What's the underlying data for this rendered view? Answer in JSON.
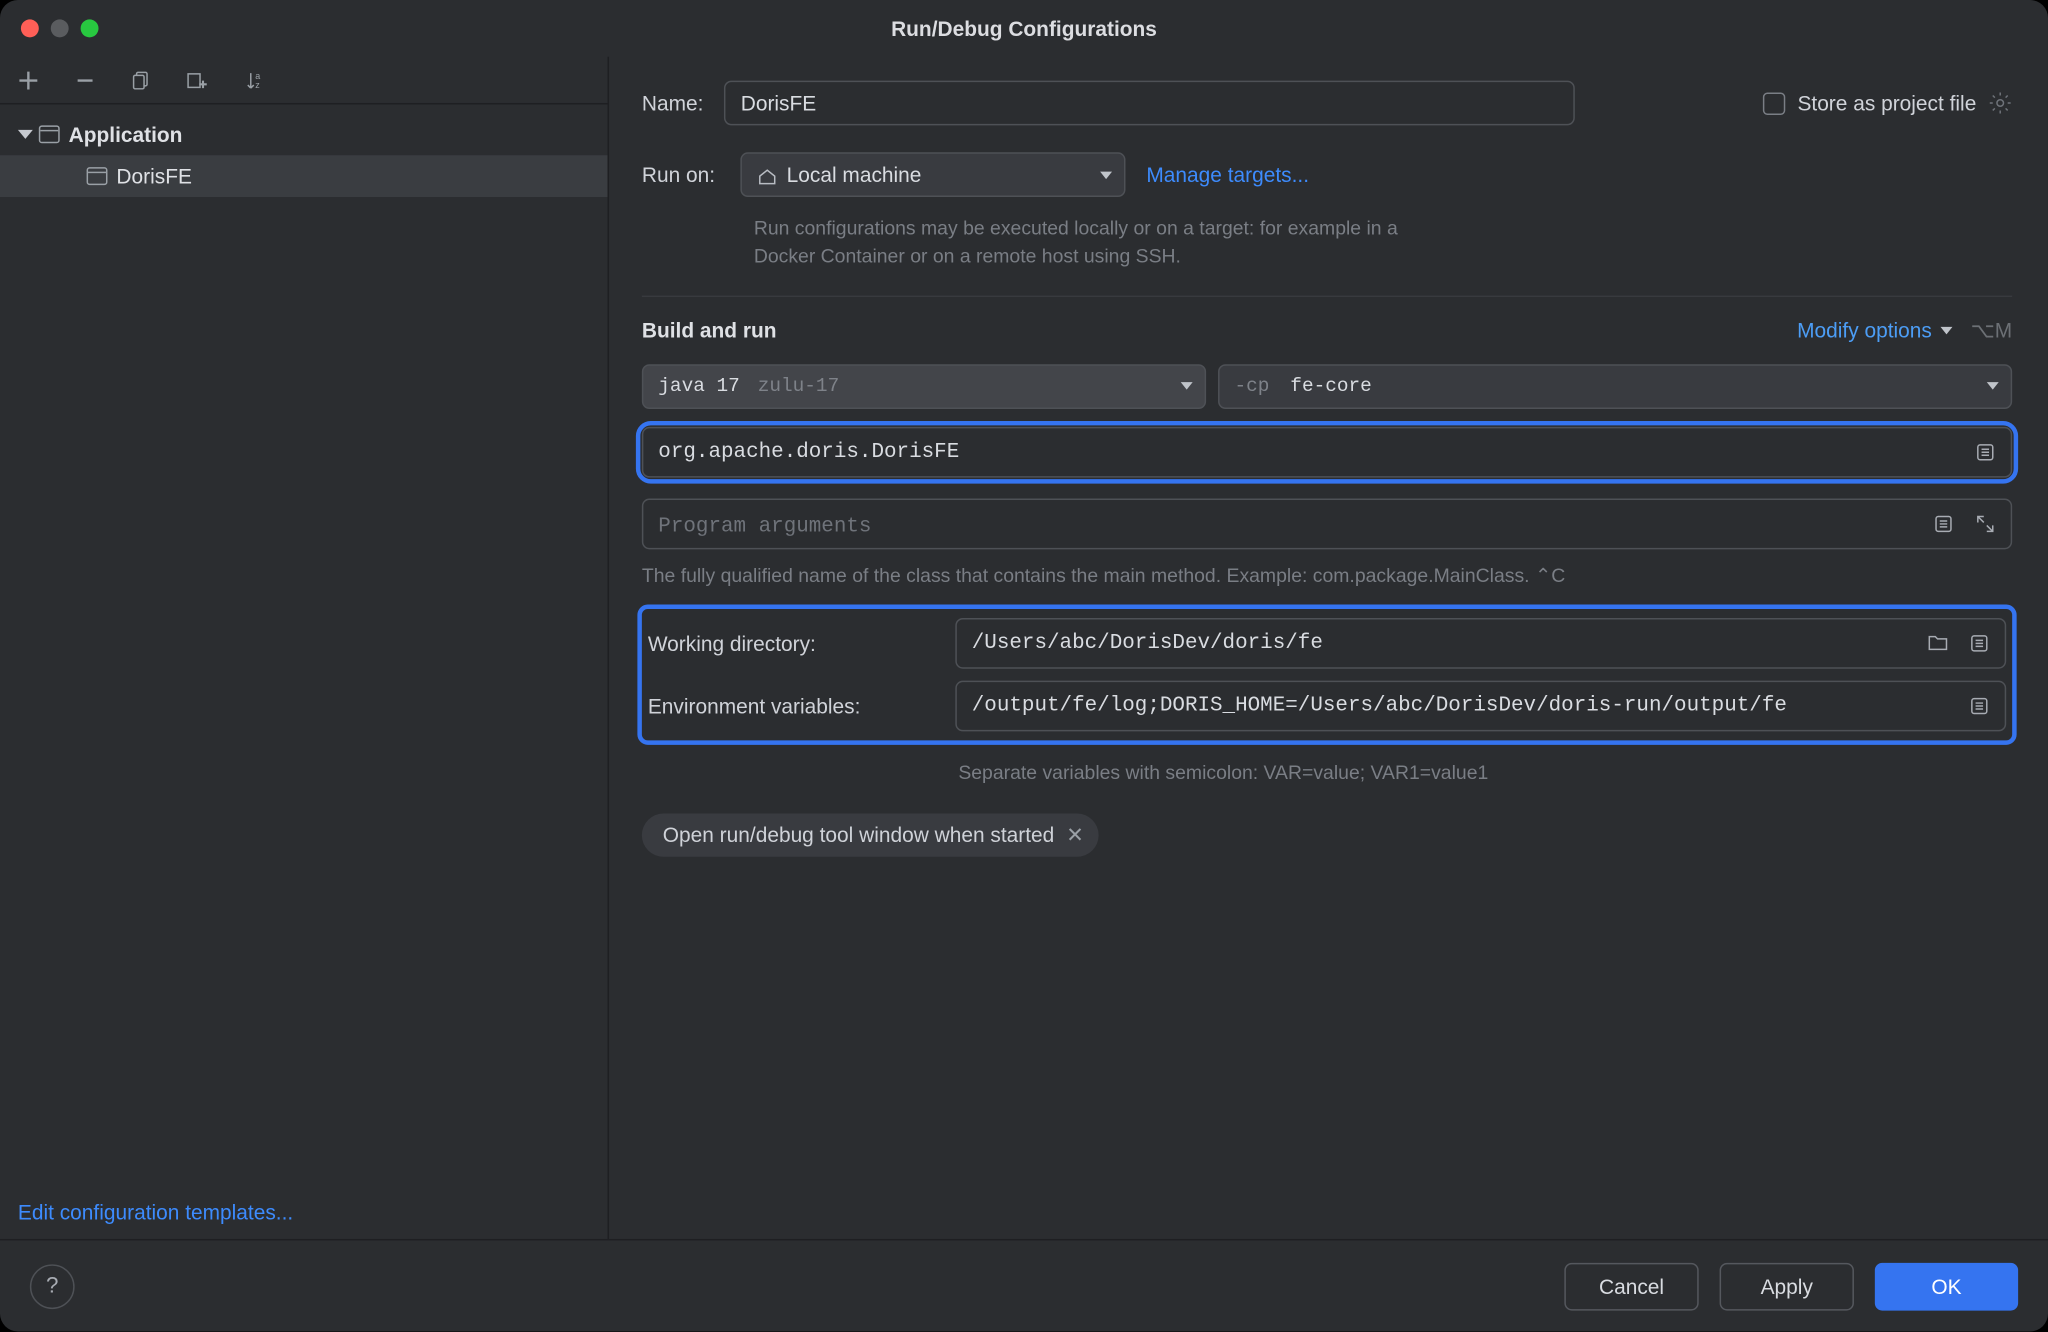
{
  "title": "Run/Debug Configurations",
  "sidebar": {
    "edit_templates": "Edit configuration templates...",
    "tree": {
      "root_label": "Application",
      "item_label": "DorisFE"
    }
  },
  "panel": {
    "name_label": "Name:",
    "name_value": "DorisFE",
    "store_label": "Store as project file",
    "runon_label": "Run on:",
    "runon_value": "Local machine",
    "manage_targets": "Manage targets...",
    "runon_help": "Run configurations may be executed locally or on a target: for example in a Docker Container or on a remote host using SSH.",
    "build_run_title": "Build and run",
    "modify_options": "Modify options",
    "modify_shortcut": "⌥M",
    "jdk_main": "java 17",
    "jdk_sub": "zulu-17",
    "cp_prefix": "-cp",
    "cp_module": "fe-core",
    "main_class": "org.apache.doris.DorisFE",
    "program_args_placeholder": "Program arguments",
    "main_class_hint": "The fully qualified name of the class that contains the main method. Example: com.package.MainClass. ⌃C",
    "workdir_label": "Working directory:",
    "workdir_value": "/Users/abc/DorisDev/doris/fe",
    "envvar_label": "Environment variables:",
    "envvar_value": "/output/fe/log;DORIS_HOME=/Users/abc/DorisDev/doris-run/output/fe",
    "envvar_hint": "Separate variables with semicolon: VAR=value; VAR1=value1",
    "chip_label": "Open run/debug tool window when started"
  },
  "footer": {
    "cancel": "Cancel",
    "apply": "Apply",
    "ok": "OK"
  }
}
